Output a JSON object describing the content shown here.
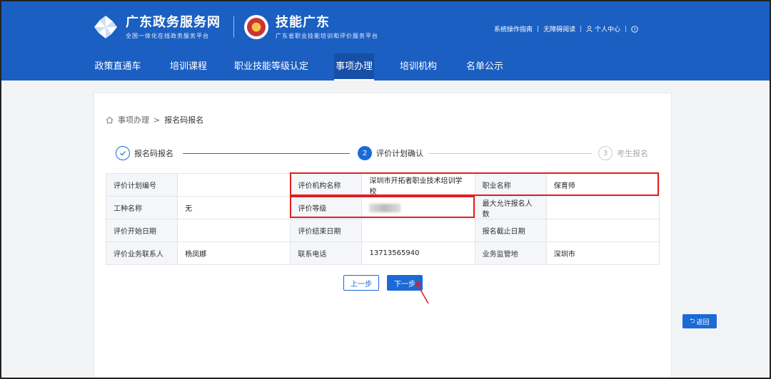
{
  "header": {
    "site_title": "广东政务服务网",
    "site_subtitle": "全国一体化在线政务服务平台",
    "skill_title": "技能广东",
    "skill_subtitle": "广东省职业技能培训和评价服务平台",
    "links": [
      "系统操作指南",
      "无障碍阅读",
      "个人中心"
    ],
    "separator": "|",
    "accent_color": "#1b5fc2"
  },
  "nav": [
    "政策直通车",
    "培训课程",
    "职业技能等级认定",
    "事项办理",
    "培训机构",
    "名单公示"
  ],
  "nav_active": "事项办理",
  "breadcrumb": {
    "home": "事项办理",
    "sep": ">",
    "current": "报名码报名"
  },
  "steps": [
    {
      "num": "✓",
      "label": "报名码报名",
      "state": "done"
    },
    {
      "num": "2",
      "label": "评价计划确认",
      "state": "active"
    },
    {
      "num": "3",
      "label": "考生报名",
      "state": "pending"
    }
  ],
  "table": {
    "rows": [
      [
        {
          "k": "评价计划编号",
          "v": ""
        },
        {
          "k": "评价机构名称",
          "v": "深圳市开拓者职业技术培训学校"
        },
        {
          "k": "职业名称",
          "v": "保育师"
        }
      ],
      [
        {
          "k": "工种名称",
          "v": "无"
        },
        {
          "k": "评价等级",
          "v": ""
        },
        {
          "k": "最大允许报名人数",
          "v": ""
        }
      ],
      [
        {
          "k": "评价开始日期",
          "v": ""
        },
        {
          "k": "评价结束日期",
          "v": ""
        },
        {
          "k": "报名截止日期",
          "v": ""
        }
      ],
      [
        {
          "k": "评价业务联系人",
          "v": "杨凤娜"
        },
        {
          "k": "联系电话",
          "v": "13713565940"
        },
        {
          "k": "业务监管地",
          "v": "深圳市"
        }
      ]
    ]
  },
  "buttons": {
    "prev": "上一步",
    "next": "下一步",
    "back": "返回"
  },
  "icons": {
    "home": "home-icon",
    "check": "check-icon",
    "user": "user-icon",
    "help": "help-icon",
    "back": "return-icon"
  },
  "colors": {
    "primary": "#1b6ad6",
    "annotation": "#e02020"
  }
}
